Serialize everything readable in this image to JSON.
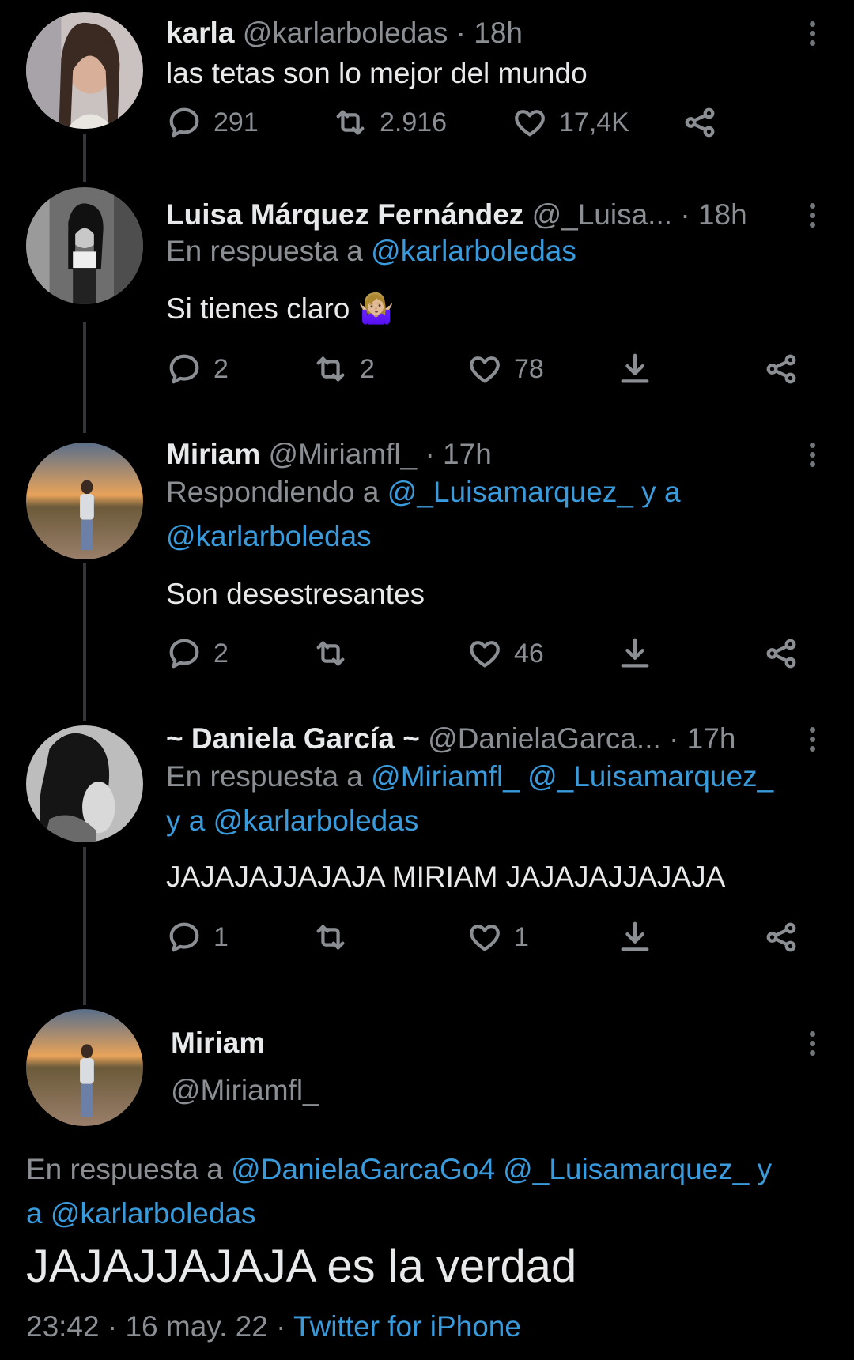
{
  "tweets": [
    {
      "name": "karla",
      "handle": "@karlarboledas",
      "time": "· 18h",
      "text": "las tetas son lo mejor del mundo",
      "replies": "291",
      "retweets": "2.916",
      "likes": "17,4K"
    },
    {
      "name": "Luisa Márquez Fernández",
      "handle": "@_Luisa...",
      "time": "· 18h",
      "reply_prefix": "En respuesta a",
      "reply_mentions": "@karlarboledas",
      "text": "Si tienes claro 🤷🏼‍♀️",
      "replies": "2",
      "retweets": "2",
      "likes": "78"
    },
    {
      "name": "Miriam",
      "handle": "@Miriamfl_",
      "time": "· 17h",
      "reply_prefix": "Respondiendo a",
      "reply_mentions_line1": "@_Luisamarquez_ y a",
      "reply_mentions_line2": "@karlarboledas",
      "text": "Son desestresantes",
      "replies": "2",
      "retweets": "",
      "likes": "46"
    },
    {
      "name": "~ Daniela García ~",
      "handle": "@DanielaGarca...",
      "time": "· 17h",
      "reply_prefix": "En respuesta a",
      "reply_mentions_line1": "@Miriamfl_ @_Luisamarquez_",
      "reply_mentions_line2": "y a @karlarboledas",
      "text": "JAJAJAJJAJAJA MIRIAM JAJAJAJJAJAJA",
      "replies": "1",
      "retweets": "",
      "likes": "1"
    }
  ],
  "main": {
    "name": "Miriam",
    "handle": "@Miriamfl_",
    "reply_prefix": "En respuesta a",
    "reply_mentions_line1": "@DanielaGarcaGo4 @_Luisamarquez_ y",
    "reply_mentions_line2": "a @karlarboledas",
    "text": "JAJAJJAJAJA es la verdad",
    "time": "23:42",
    "date": "16 may. 22",
    "sep1": "·",
    "sep2": "·",
    "source": "Twitter for iPhone"
  },
  "colors": {
    "background": "#000000",
    "link": "#3a9bdc",
    "secondary": "#8b8f94",
    "thread_line": "#333639"
  }
}
